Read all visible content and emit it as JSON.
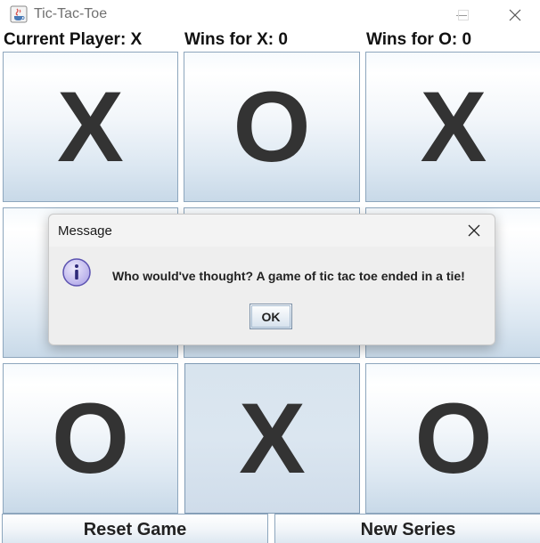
{
  "window": {
    "title": "Tic-Tac-Toe"
  },
  "status": {
    "current_player": "Current Player: X",
    "wins_x": "Wins for X: 0",
    "wins_o": "Wins for O: 0"
  },
  "board": {
    "cells": [
      "X",
      "O",
      "X",
      "",
      "",
      "",
      "O",
      "X",
      "O"
    ]
  },
  "buttons": {
    "reset": "Reset Game",
    "new_series": "New Series"
  },
  "dialog": {
    "title": "Message",
    "message": "Who would've thought? A game of tic tac toe ended in a tie!",
    "ok_label": "OK",
    "icon": "info-icon"
  },
  "colors": {
    "mark": "#333333",
    "cell_border": "#8da6bd",
    "info_icon_fill": "#c9c2ef",
    "info_icon_stroke": "#5b52b0"
  }
}
